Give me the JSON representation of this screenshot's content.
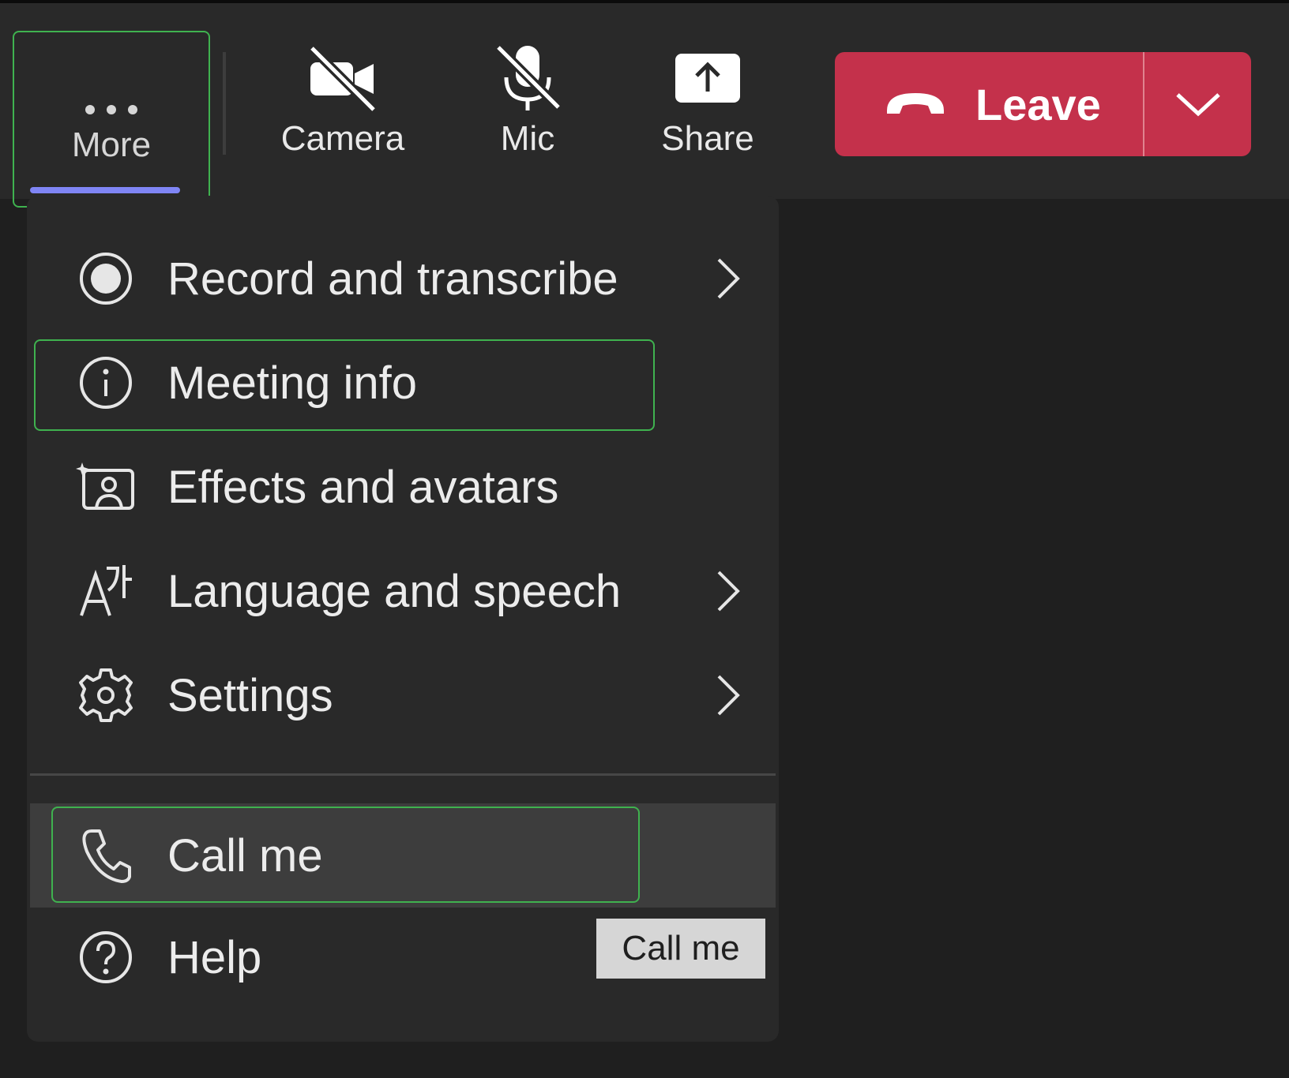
{
  "toolbar": {
    "more": {
      "label": "More",
      "icon": "more-icon"
    },
    "camera": {
      "label": "Camera",
      "icon": "camera-off-icon"
    },
    "mic": {
      "label": "Mic",
      "icon": "mic-off-icon"
    },
    "share": {
      "label": "Share",
      "icon": "share-icon"
    },
    "leave": {
      "label": "Leave",
      "icon": "phone-hangup-icon",
      "color": "#c4314b"
    }
  },
  "menu": {
    "items": [
      {
        "label": "Record and transcribe",
        "icon": "record-icon",
        "has_submenu": true
      },
      {
        "label": "Meeting info",
        "icon": "info-icon",
        "has_submenu": false
      },
      {
        "label": "Effects and avatars",
        "icon": "effects-icon",
        "has_submenu": false
      },
      {
        "label": "Language and speech",
        "icon": "language-icon",
        "has_submenu": true
      },
      {
        "label": "Settings",
        "icon": "gear-icon",
        "has_submenu": true
      },
      {
        "label": "Call me",
        "icon": "phone-icon",
        "has_submenu": false,
        "hovered": true
      },
      {
        "label": "Help",
        "icon": "help-icon",
        "has_submenu": false
      }
    ]
  },
  "tooltip": {
    "text": "Call me"
  },
  "colors": {
    "accent": "#7f85f5",
    "highlight_outline": "#3fb24f",
    "leave_red": "#c4314b"
  }
}
